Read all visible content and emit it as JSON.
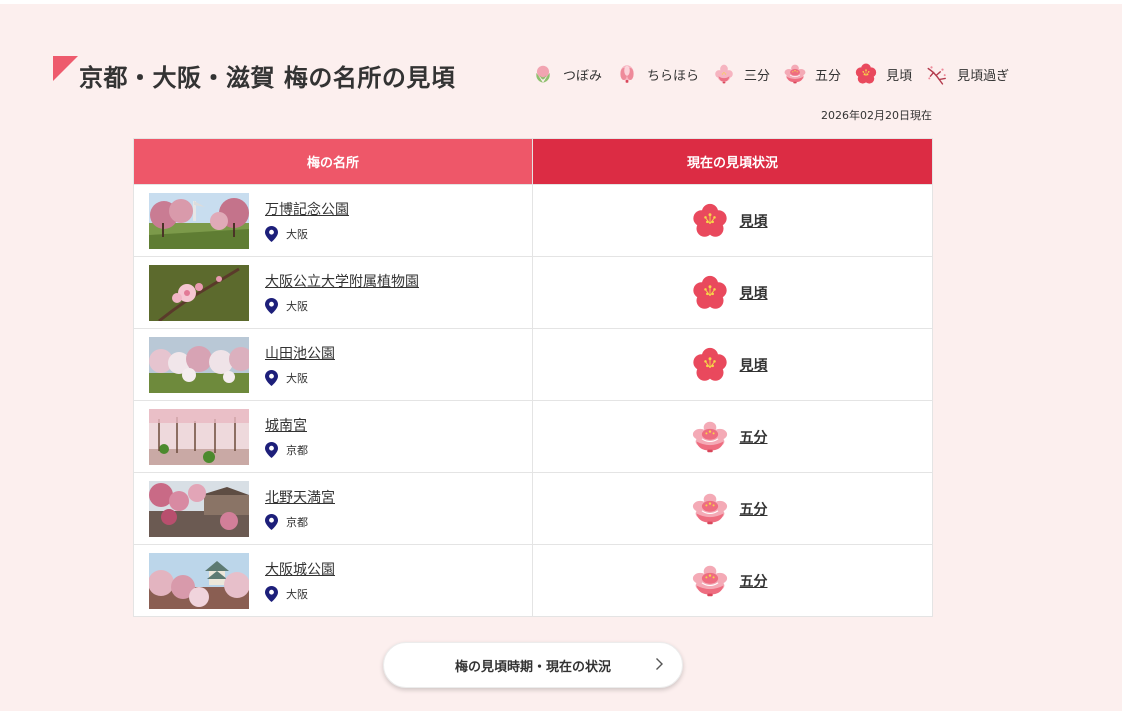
{
  "header": {
    "title": "京都・大阪・滋賀 梅の名所の見頃",
    "date": "2026年02月20日現在"
  },
  "legend": [
    {
      "label": "つぼみ",
      "icon": "bud-icon"
    },
    {
      "label": "ちらほら",
      "icon": "few-blooms-icon"
    },
    {
      "label": "三分",
      "icon": "thirty-percent-icon"
    },
    {
      "label": "五分",
      "icon": "fifty-percent-icon"
    },
    {
      "label": "見頃",
      "icon": "full-bloom-icon"
    },
    {
      "label": "見頃過ぎ",
      "icon": "past-peak-icon"
    }
  ],
  "table": {
    "headers": {
      "name": "梅の名所",
      "status": "現在の見頃状況"
    },
    "rows": [
      {
        "name": "万博記念公園",
        "location": "大阪",
        "status": "見頃",
        "status_icon": "full-bloom-icon"
      },
      {
        "name": "大阪公立大学附属植物園",
        "location": "大阪",
        "status": "見頃",
        "status_icon": "full-bloom-icon"
      },
      {
        "name": "山田池公園",
        "location": "大阪",
        "status": "見頃",
        "status_icon": "full-bloom-icon"
      },
      {
        "name": "城南宮",
        "location": "京都",
        "status": "五分",
        "status_icon": "fifty-percent-icon"
      },
      {
        "name": "北野天満宮",
        "location": "京都",
        "status": "五分",
        "status_icon": "fifty-percent-icon"
      },
      {
        "name": "大阪城公園",
        "location": "大阪",
        "status": "五分",
        "status_icon": "fifty-percent-icon"
      }
    ]
  },
  "button": {
    "label": "梅の見頃時期・現在の状況"
  },
  "colors": {
    "background": "#fcefee",
    "accent": "#ee5769",
    "accent_dark": "#dc2c44",
    "pin": "#1d1f7a"
  }
}
